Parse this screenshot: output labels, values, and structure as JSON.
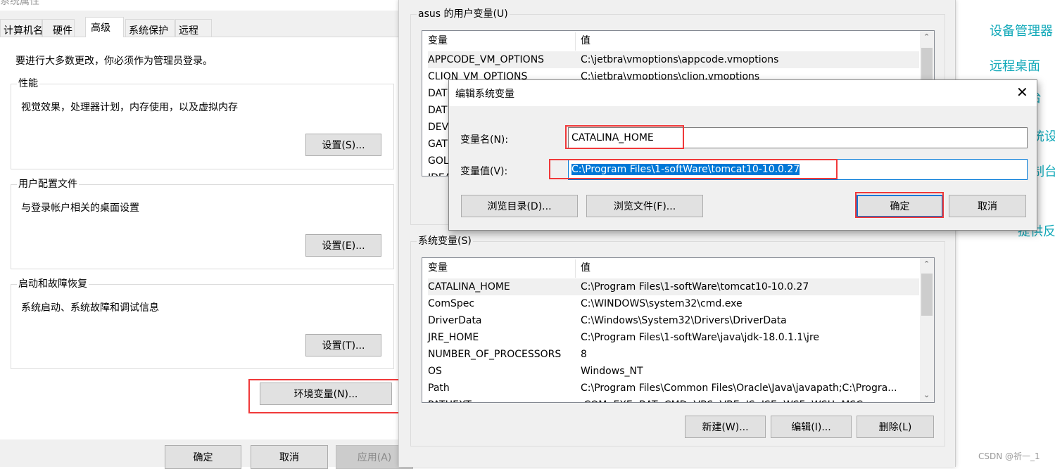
{
  "sysprops": {
    "title": "系统属性",
    "tabs": [
      "计算机名",
      "硬件",
      "高级",
      "系统保护",
      "远程"
    ],
    "active_tab": "高级",
    "admin_note": "要进行大多数更改，你必须作为管理员登录。",
    "groups": [
      {
        "label": "性能",
        "desc": "视觉效果，处理器计划，内存使用，以及虚拟内存",
        "button": "设置(S)..."
      },
      {
        "label": "用户配置文件",
        "desc": "与登录帐户相关的桌面设置",
        "button": "设置(E)..."
      },
      {
        "label": "启动和故障恢复",
        "desc": "系统启动、系统故障和调试信息",
        "button": "设置(T)..."
      }
    ],
    "env_button": "环境变量(N)...",
    "ok": "确定",
    "cancel": "取消",
    "apply": "应用(A)"
  },
  "envvars": {
    "user_group_label": "asus 的用户变量(U)",
    "col_var": "变量",
    "col_val": "值",
    "user_rows": [
      [
        "APPCODE_VM_OPTIONS",
        "C:\\jetbra\\vmoptions\\appcode.vmoptions"
      ],
      [
        "CLION_VM_OPTIONS",
        "C:\\jetbra\\vmoptions\\clion.vmoptions"
      ],
      [
        "DAT",
        ""
      ],
      [
        "DAT",
        ""
      ],
      [
        "DEV",
        ""
      ],
      [
        "GAT",
        ""
      ],
      [
        "GOL",
        ""
      ],
      [
        "IDEA",
        ""
      ]
    ],
    "sys_group_label": "系统变量(S)",
    "sys_rows": [
      [
        "CATALINA_HOME",
        "C:\\Program Files\\1-softWare\\tomcat10-10.0.27"
      ],
      [
        "ComSpec",
        "C:\\WINDOWS\\system32\\cmd.exe"
      ],
      [
        "DriverData",
        "C:\\Windows\\System32\\Drivers\\DriverData"
      ],
      [
        "JRE_HOME",
        "C:\\Program Files\\1-softWare\\java\\jdk-18.0.1.1\\jre"
      ],
      [
        "NUMBER_OF_PROCESSORS",
        "8"
      ],
      [
        "OS",
        "Windows_NT"
      ],
      [
        "Path",
        "C:\\Program Files\\Common Files\\Oracle\\Java\\javapath;C:\\Progra..."
      ],
      [
        "PATHEXT",
        ".COM;.EXE;.BAT;.CMD;.VBS;.VBE;.JS;.JSE;.WSF;.WSH;.MSC"
      ]
    ],
    "new": "新建(W)...",
    "edit": "编辑(I)...",
    "delete": "删除(L)"
  },
  "edit_dialog": {
    "title": "编辑系统变量",
    "name_label": "变量名(N):",
    "name_value": "CATALINA_HOME",
    "value_label": "变量值(V):",
    "value_value": "C:\\Program Files\\1-softWare\\tomcat10-10.0.27",
    "browse_dir": "浏览目录(D)...",
    "browse_file": "浏览文件(F)...",
    "ok": "确定",
    "cancel": "取消"
  },
  "side_links": [
    "设备管理器",
    "远程桌面",
    "台",
    "统设",
    "控制台",
    "提供反"
  ],
  "watermark": "CSDN @祈一_1",
  "colors": {
    "highlight": "#f0393a",
    "selection": "#0078d7",
    "link": "#10a8b8"
  }
}
